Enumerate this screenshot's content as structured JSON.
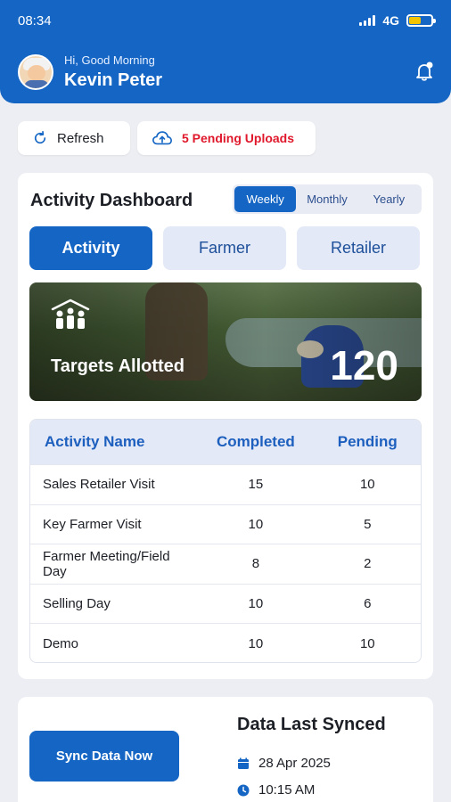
{
  "status_bar": {
    "time": "08:34",
    "network": "4G"
  },
  "header": {
    "greeting": "Hi, Good Morning",
    "user_name": "Kevin Peter"
  },
  "actions": {
    "refresh_label": "Refresh",
    "pending_label": "5 Pending Uploads"
  },
  "dashboard": {
    "title": "Activity Dashboard",
    "periods": [
      "Weekly",
      "Monthly",
      "Yearly"
    ],
    "selected_period": "Weekly",
    "tabs": [
      "Activity",
      "Farmer",
      "Retailer"
    ],
    "selected_tab": "Activity",
    "targets": {
      "label": "Targets Allotted",
      "value": "120"
    },
    "table": {
      "headers": [
        "Activity Name",
        "Completed",
        "Pending"
      ],
      "rows": [
        {
          "name": "Sales Retailer Visit",
          "completed": "15",
          "pending": "10"
        },
        {
          "name": "Key Farmer Visit",
          "completed": "10",
          "pending": "5"
        },
        {
          "name": "Farmer Meeting/Field Day",
          "completed": "8",
          "pending": "2"
        },
        {
          "name": "Selling Day",
          "completed": "10",
          "pending": "6"
        },
        {
          "name": "Demo",
          "completed": "10",
          "pending": "10"
        }
      ]
    }
  },
  "sync": {
    "button_label": "Sync Data Now",
    "title": "Data Last Synced",
    "date": "28 Apr 2025",
    "time": "10:15 AM"
  },
  "colors": {
    "primary": "#1566c4",
    "alert": "#e0182c"
  }
}
